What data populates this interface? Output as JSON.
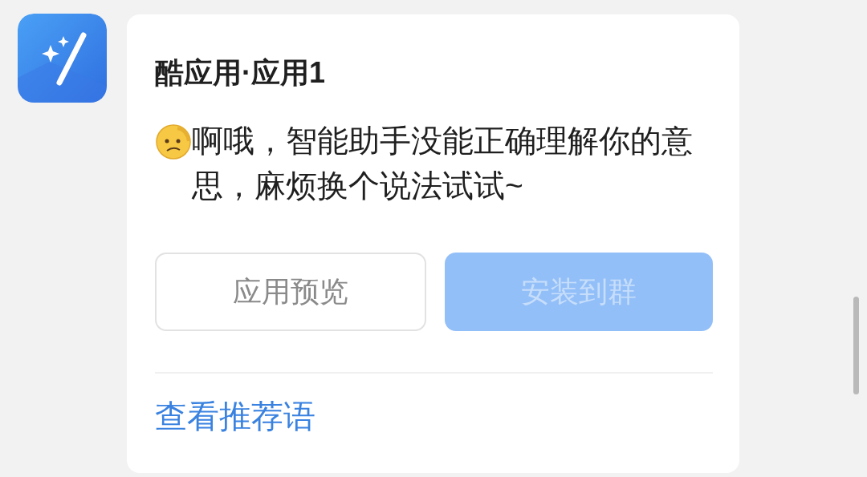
{
  "card": {
    "title": "酷应用·应用1",
    "message": "啊哦，智能助手没能正确理解你的意思，麻烦换个说法试试~",
    "buttons": [
      {
        "label": "应用预览",
        "kind": "outline",
        "disabled": false
      },
      {
        "label": "安装到群",
        "kind": "primary",
        "disabled": true
      }
    ],
    "link": "查看推荐语"
  }
}
